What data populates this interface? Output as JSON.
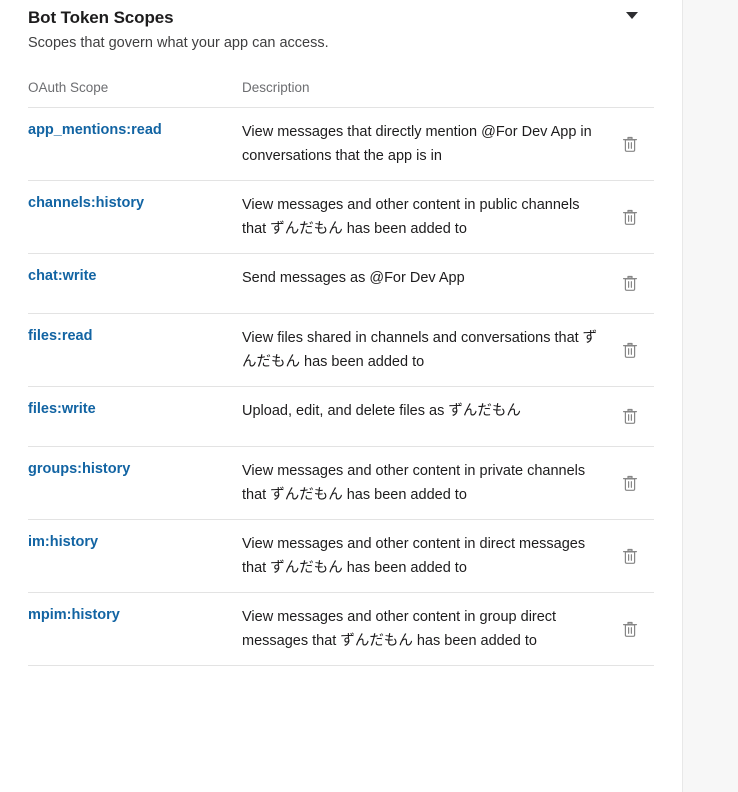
{
  "section": {
    "title": "Bot Token Scopes",
    "subtitle": "Scopes that govern what your app can access.",
    "collapse_icon": "chevron-down-icon"
  },
  "table": {
    "headers": {
      "scope": "OAuth Scope",
      "description": "Description"
    },
    "delete_icon": "trash-icon",
    "rows": [
      {
        "scope": "app_mentions:read",
        "description": "View messages that directly mention @For Dev App in conversations that the app is in"
      },
      {
        "scope": "channels:history",
        "description": "View messages and other content in public channels that ずんだもん has been added to"
      },
      {
        "scope": "chat:write",
        "description": "Send messages as @For Dev App"
      },
      {
        "scope": "files:read",
        "description": "View files shared in channels and conversations that ずんだもん has been added to"
      },
      {
        "scope": "files:write",
        "description": "Upload, edit, and delete files as ずんだもん"
      },
      {
        "scope": "groups:history",
        "description": "View messages and other content in private channels that ずんだもん has been added to"
      },
      {
        "scope": "im:history",
        "description": "View messages and other content in direct messages that ずんだもん has been added to"
      },
      {
        "scope": "mpim:history",
        "description": "View messages and other content in group direct messages that ずんだもん has been added to"
      }
    ]
  },
  "colors": {
    "link": "#1264a3",
    "text": "#1d1c1d",
    "muted": "#6d6e71",
    "divider": "#e3e3e3",
    "page_background": "#f7f7f7",
    "panel_background": "#ffffff"
  }
}
